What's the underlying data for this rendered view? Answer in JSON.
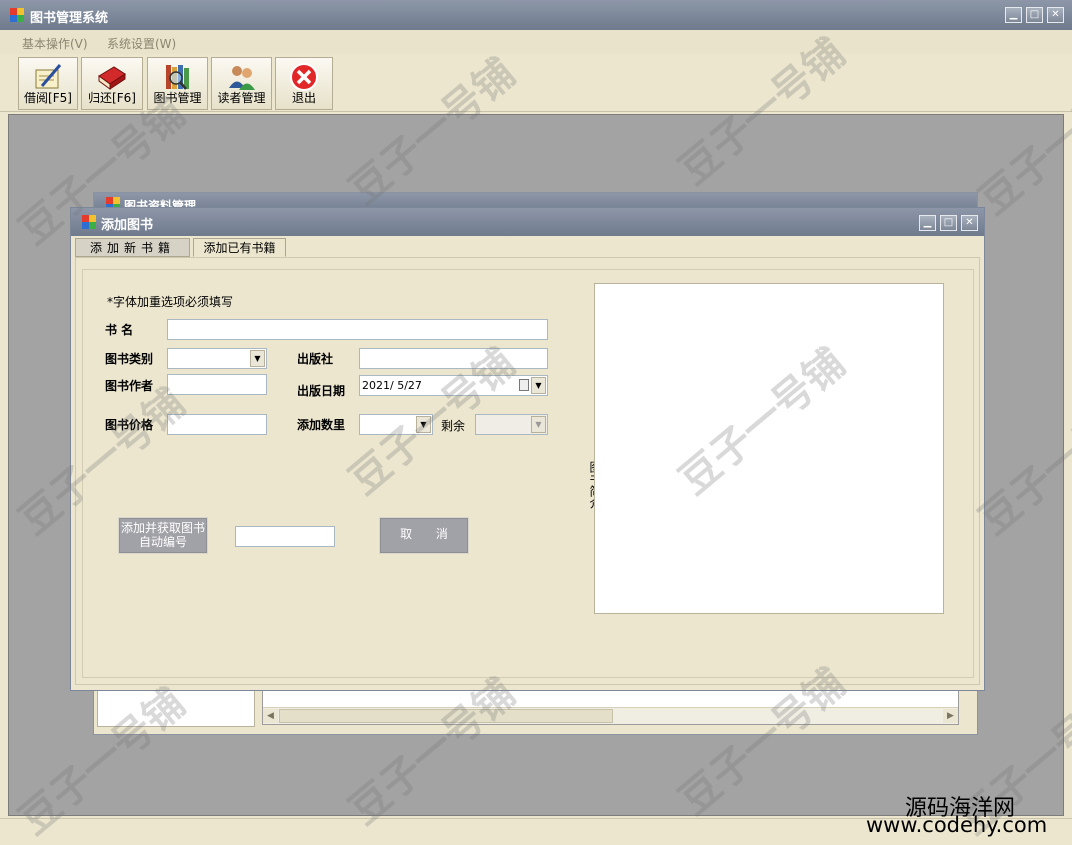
{
  "app": {
    "title": "图书管理系统",
    "menu": [
      "基本操作(V)",
      "系统设置(W)"
    ],
    "toolbar": [
      {
        "label": "借阅[F5]",
        "icon": "pen-paper-icon"
      },
      {
        "label": "归还[F6]",
        "icon": "red-book-icon"
      },
      {
        "label": "图书管理",
        "icon": "books-magnifier-icon"
      },
      {
        "label": "读者管理",
        "icon": "users-icon"
      },
      {
        "label": "退出",
        "icon": "close-circle-icon"
      }
    ],
    "window_buttons": [
      "▁",
      "□",
      "✕"
    ]
  },
  "background_window": {
    "title": "图书资料管理"
  },
  "dialog": {
    "title": "添加图书",
    "tabs": [
      "添加新书籍",
      "添加已有书籍"
    ],
    "note": "*字体加重选项必须填写",
    "labels": {
      "book_name": "书 名",
      "category": "图书类别",
      "publisher": "出版社",
      "author": "图书作者",
      "pub_date": "出版日期",
      "price": "图书价格",
      "quantity": "添加数里",
      "remaining": "剩余",
      "intro": "图书简介"
    },
    "values": {
      "book_name": "",
      "category": "",
      "publisher": "",
      "author": "",
      "pub_date": "2021/ 5/27",
      "price": "",
      "quantity": "",
      "remaining": "",
      "auto_number": ""
    },
    "buttons": {
      "add": "添加并获取图书自动编号",
      "cancel": "取 消"
    }
  },
  "watermark": {
    "text": "豆子一号铺"
  },
  "brand": {
    "line1": "源码海洋网",
    "line2": "www.codehy.com"
  },
  "colors": {
    "titlebar": "#7d879a",
    "body": "#ece6cf",
    "mdi": "#a3a3a3"
  }
}
